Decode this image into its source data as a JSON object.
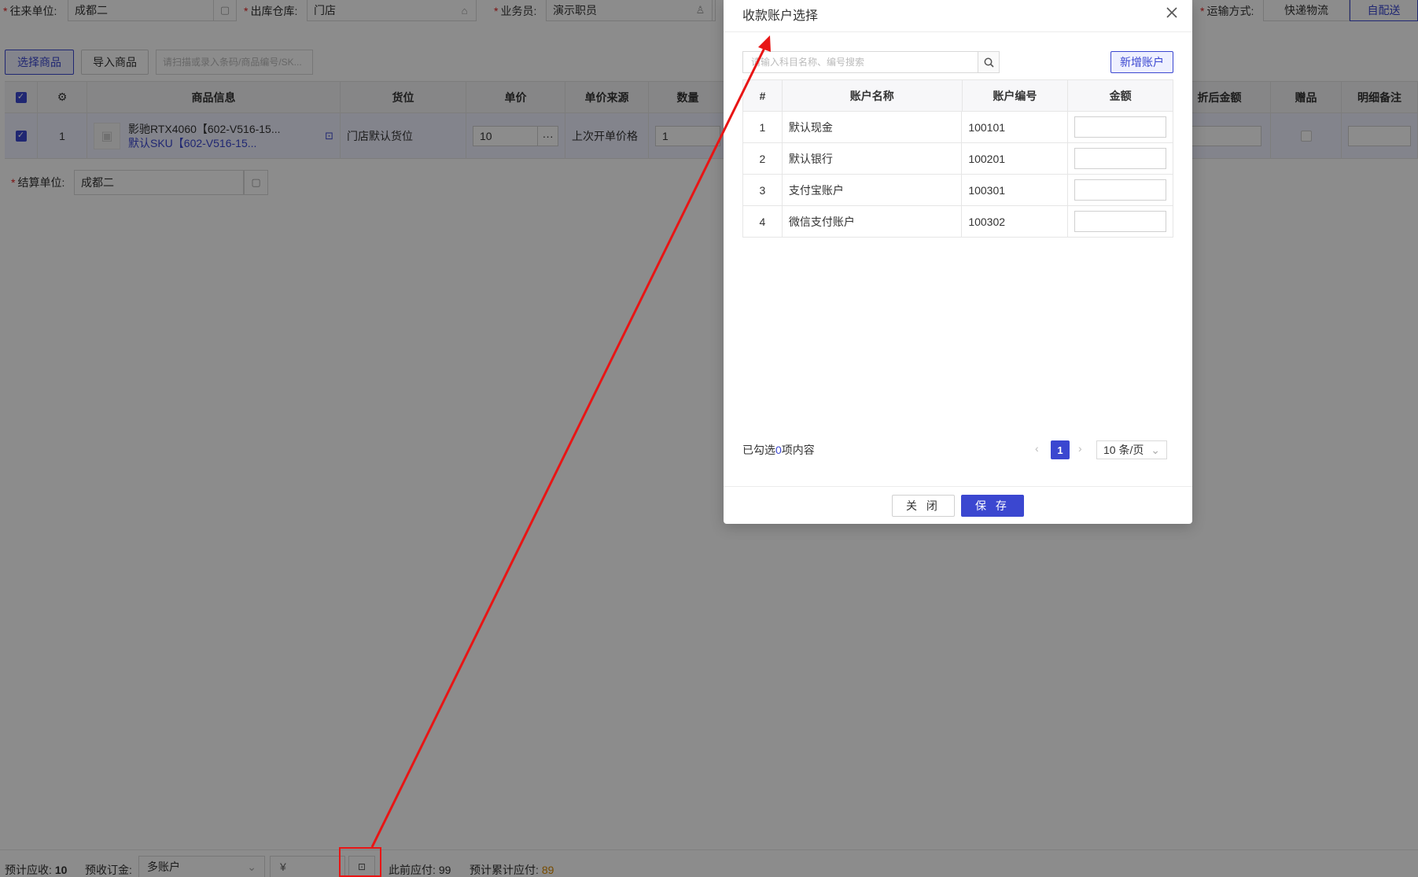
{
  "form": {
    "partner_label": "往来单位:",
    "partner_value": "成都二",
    "warehouse_label": "出库仓库:",
    "warehouse_value": "门店",
    "salesman_label": "业务员:",
    "salesman_value": "演示职员",
    "shipping_label": "运输方式:",
    "shipping_options": [
      "快递物流",
      "自配送"
    ],
    "shipping_selected": "自配送"
  },
  "toolbar": {
    "select_goods": "选择商品",
    "import_goods": "导入商品",
    "scan_placeholder": "请扫描或录入条码/商品编号/SK..."
  },
  "grid": {
    "columns": [
      "商品信息",
      "货位",
      "单价",
      "单价来源",
      "数量",
      "折后金额",
      "赠品",
      "明细备注"
    ],
    "row": {
      "index": "1",
      "product_name": "影驰RTX4060【602-V516-15...",
      "product_sku": "默认SKU【602-V516-15...",
      "location": "门店默认货位",
      "price": "10",
      "price_more": "···",
      "price_source": "上次开单价格",
      "qty": "1"
    }
  },
  "settlement": {
    "label": "结算单位:",
    "value": "成都二"
  },
  "bottom": {
    "expected_receivable_label": "预计应收:",
    "expected_receivable_value": "10",
    "deposit_label": "预收订金:",
    "deposit_account": "多账户",
    "currency_symbol": "¥",
    "previous_payable_label": "此前应付:",
    "previous_payable_value": "99",
    "cumulative_payable_label": "预计累计应付:",
    "cumulative_payable_value": "89"
  },
  "modal": {
    "title": "收款账户选择",
    "search_placeholder": "请输入科目名称、编号搜索",
    "add_account": "新增账户",
    "columns": {
      "idx": "#",
      "name": "账户名称",
      "code": "账户编号",
      "amount": "金额"
    },
    "rows": [
      {
        "idx": "1",
        "name": "默认现金",
        "code": "100101"
      },
      {
        "idx": "2",
        "name": "默认银行",
        "code": "100201"
      },
      {
        "idx": "3",
        "name": "支付宝账户",
        "code": "100301"
      },
      {
        "idx": "4",
        "name": "微信支付账户",
        "code": "100302"
      }
    ],
    "selected_prefix": "已勾选",
    "selected_count": "0",
    "selected_suffix": "项内容",
    "page_current": "1",
    "page_size": "10 条/页",
    "close_label": "关 闭",
    "save_label": "保 存"
  },
  "colors": {
    "accent": "#3b47d0",
    "required": "#e02020",
    "annotation": "#e81515",
    "warning_value": "#d98b00"
  }
}
